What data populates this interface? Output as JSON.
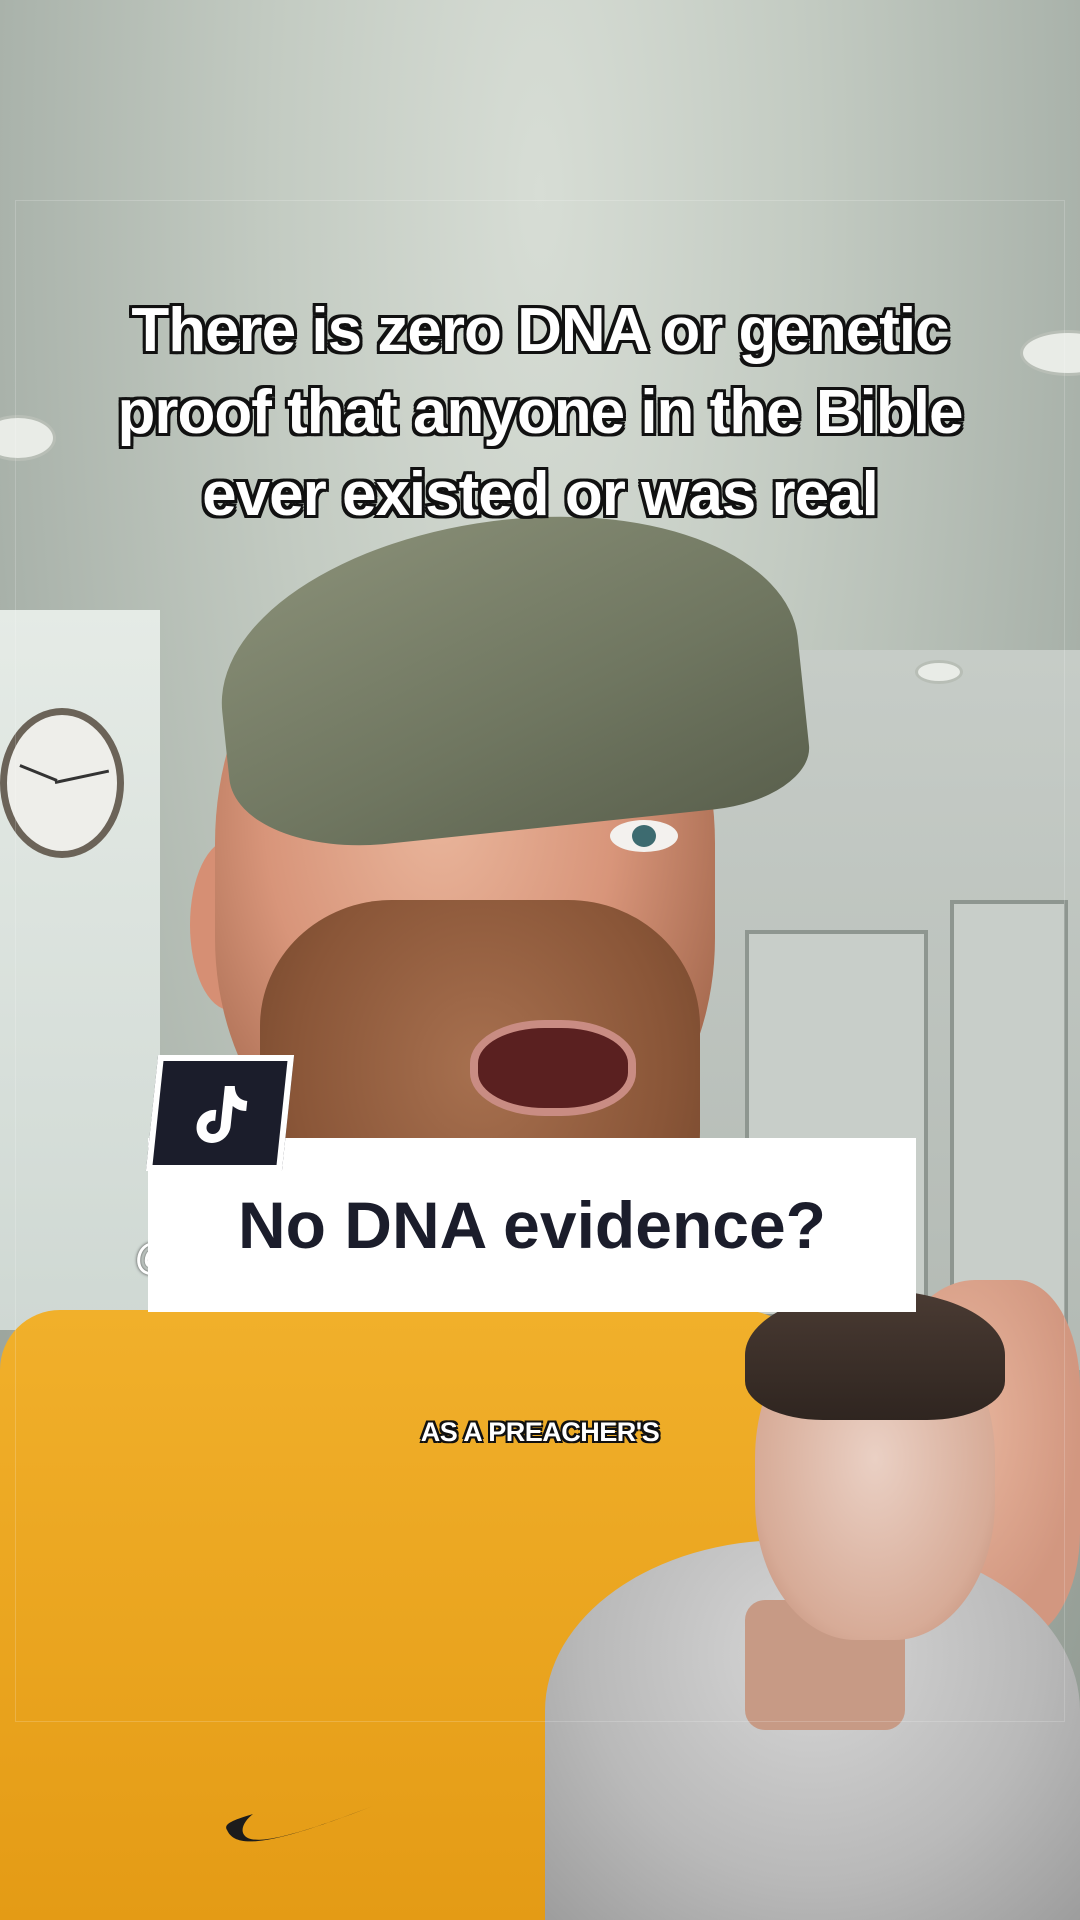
{
  "caption": {
    "lines": [
      "There is zero DNA or genetic",
      "proof that anyone in the Bible",
      "ever existed or was real"
    ]
  },
  "title_card": {
    "text": "No DNA evidence?"
  },
  "handle_prefix": "@",
  "subtitle": "AS A PREACHER'S",
  "icons": {
    "logo": "tiktok-logo-icon",
    "swoosh": "nike-swoosh-icon"
  },
  "colors": {
    "card_bg": "#ffffff",
    "card_text": "#1b1d2b",
    "logo_bg": "#1b1d2b",
    "shirt": "#f1b02b"
  }
}
